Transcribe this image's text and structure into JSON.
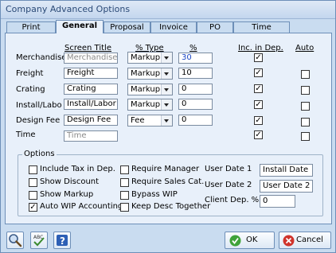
{
  "window": {
    "title": "Company Advanced Options"
  },
  "tabs": [
    {
      "label": "Print",
      "active": false
    },
    {
      "label": "General",
      "active": true
    },
    {
      "label": "Proposal",
      "active": false
    },
    {
      "label": "Invoice",
      "active": false
    },
    {
      "label": "PO",
      "active": false
    },
    {
      "label": "Time",
      "active": false
    }
  ],
  "columns": {
    "screen_title": "Screen Title",
    "pct_type": "% Type",
    "pct": "%",
    "inc_in_dep": "Inc. in Dep.",
    "auto": "Auto"
  },
  "rows": [
    {
      "label": "Merchandise",
      "title": "Merchandise",
      "type": "Markup",
      "pct": "30",
      "inc": true,
      "auto": null
    },
    {
      "label": "Freight",
      "title": "Freight",
      "type": "Markup",
      "pct": "10",
      "inc": true,
      "auto": false
    },
    {
      "label": "Crating",
      "title": "Crating",
      "type": "Markup",
      "pct": "0",
      "inc": true,
      "auto": false
    },
    {
      "label": "Install/Labo",
      "title": "Install/Labor",
      "type": "Markup",
      "pct": "0",
      "inc": true,
      "auto": false
    },
    {
      "label": "Design Fee",
      "title": "Design Fee",
      "type": "Fee",
      "pct": "0",
      "inc": true,
      "auto": false
    },
    {
      "label": "Time",
      "title": "Time",
      "type": null,
      "pct": null,
      "inc": true,
      "auto": false
    }
  ],
  "options": {
    "legend": "Options",
    "left": [
      {
        "label": "Include Tax in Dep.",
        "checked": false
      },
      {
        "label": "Show Discount",
        "checked": false
      },
      {
        "label": "Show Markup",
        "checked": false
      },
      {
        "label": "Auto WIP Accounting",
        "checked": true
      }
    ],
    "middle": [
      {
        "label": "Require Manager",
        "checked": false
      },
      {
        "label": "Require Sales Cat.",
        "checked": false
      },
      {
        "label": "Bypass WIP",
        "checked": false
      },
      {
        "label": "Keep Desc Together",
        "checked": false
      }
    ],
    "user_date_1": {
      "label": "User Date 1",
      "value": "Install Date"
    },
    "user_date_2": {
      "label": "User Date 2",
      "value": "User Date 2"
    },
    "client_dep": {
      "label": "Client Dep. %",
      "value": "0"
    }
  },
  "footer": {
    "ok_label": "OK",
    "cancel_label": "Cancel"
  },
  "colors": {
    "accent": "#6d8fb8",
    "panel": "#e8f0fa",
    "window": "#c9dcf0",
    "pct_text": "#1a47c4"
  }
}
